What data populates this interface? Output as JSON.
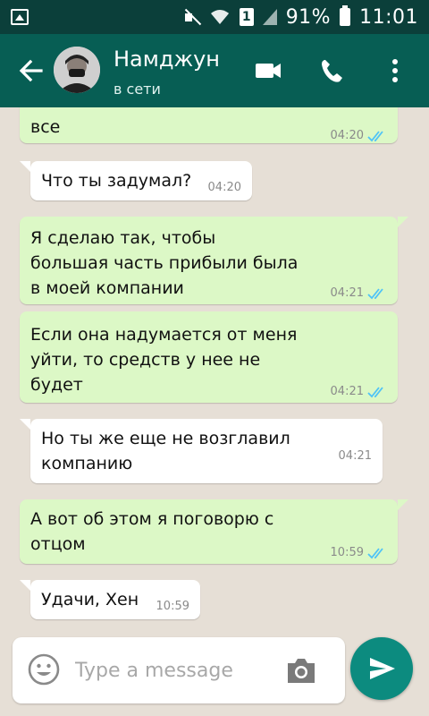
{
  "status_bar": {
    "battery": "91%",
    "time": "11:01",
    "sim": "1"
  },
  "header": {
    "contact_name": "Намджун",
    "contact_status": "в сети"
  },
  "messages": [
    {
      "direction": "out",
      "text": "все",
      "time": "04:20",
      "read": true
    },
    {
      "direction": "in",
      "text": "Что ты задумал?",
      "time": "04:20"
    },
    {
      "direction": "out",
      "text": "Я сделаю так, чтобы большая часть прибыли была в моей компании",
      "time": "04:21",
      "read": true
    },
    {
      "direction": "out",
      "text": "Если она надумается от меня уйти, то средств у нее не будет",
      "time": "04:21",
      "read": true
    },
    {
      "direction": "in",
      "text": "Но ты же еще не возглавил компанию",
      "time": "04:21"
    },
    {
      "direction": "out",
      "text": "А вот об этом я поговорю с отцом",
      "time": "10:59",
      "read": true
    },
    {
      "direction": "in",
      "text": "Удачи, Хен",
      "time": "10:59"
    }
  ],
  "composer": {
    "placeholder": "Type a message",
    "value": ""
  },
  "icons": {
    "back": "arrow-left-icon",
    "video": "video-camera-icon",
    "call": "phone-icon",
    "menu": "more-vertical-icon",
    "emoji": "emoji-icon",
    "camera": "camera-icon",
    "send": "send-icon"
  },
  "colors": {
    "header": "#075e54",
    "status_bar": "#0b3f3a",
    "outgoing_bubble": "#dcf8c6",
    "incoming_bubble": "#ffffff",
    "read_ticks": "#4fc3f7",
    "send_button": "#0c8b7f"
  }
}
